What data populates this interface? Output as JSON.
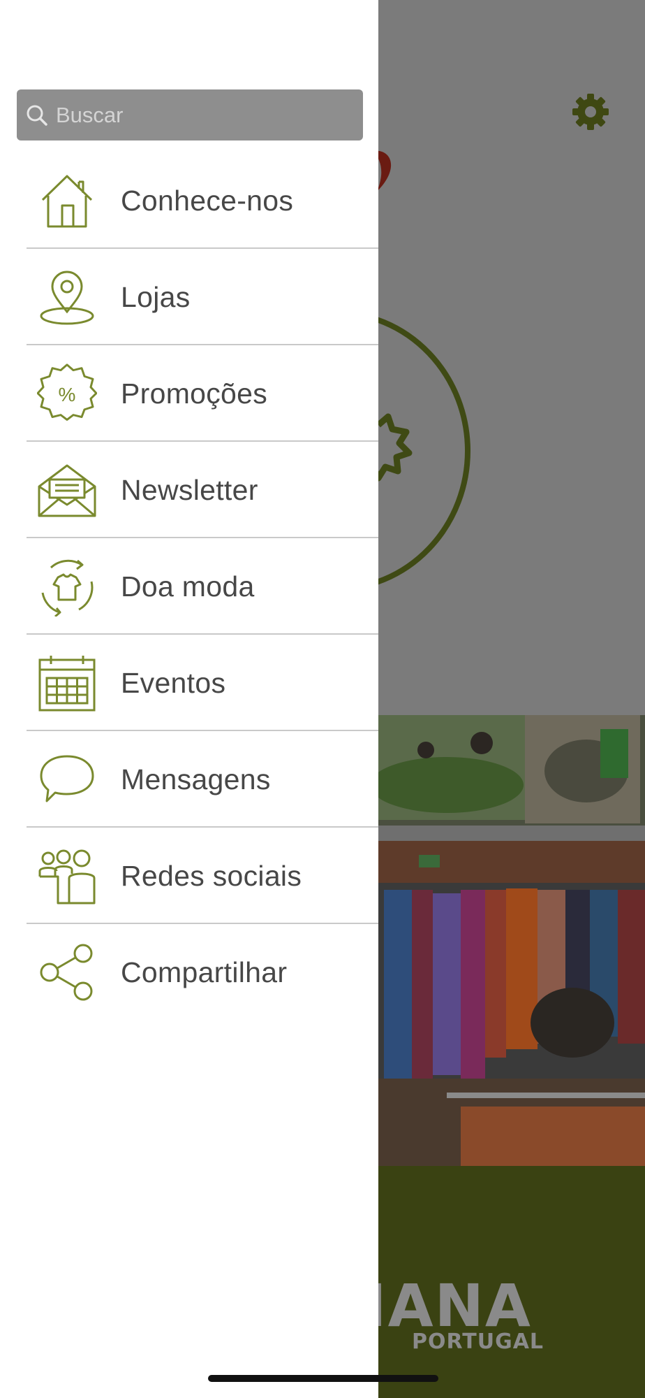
{
  "search": {
    "placeholder": "Buscar",
    "icon": "search-icon"
  },
  "menu": {
    "items": [
      {
        "label": "Conhece-nos",
        "icon": "home-icon"
      },
      {
        "label": "Lojas",
        "icon": "map-pin-icon"
      },
      {
        "label": "Promoções",
        "icon": "discount-badge-icon"
      },
      {
        "label": "Newsletter",
        "icon": "envelope-icon"
      },
      {
        "label": "Doa moda",
        "icon": "recycle-shirt-icon"
      },
      {
        "label": "Eventos",
        "icon": "calendar-icon"
      },
      {
        "label": "Mensagens",
        "icon": "chat-bubble-icon"
      },
      {
        "label": "Redes sociais",
        "icon": "people-icon"
      },
      {
        "label": "Compartilhar",
        "icon": "share-icon"
      }
    ]
  },
  "background": {
    "settings_icon": "gear-icon",
    "brand_name": "MANA",
    "brand_subtitle": "PORTUGAL"
  },
  "colors": {
    "accent": "#7a8a2e",
    "footer": "#3a4212",
    "search_bg": "#8e8e8e"
  }
}
